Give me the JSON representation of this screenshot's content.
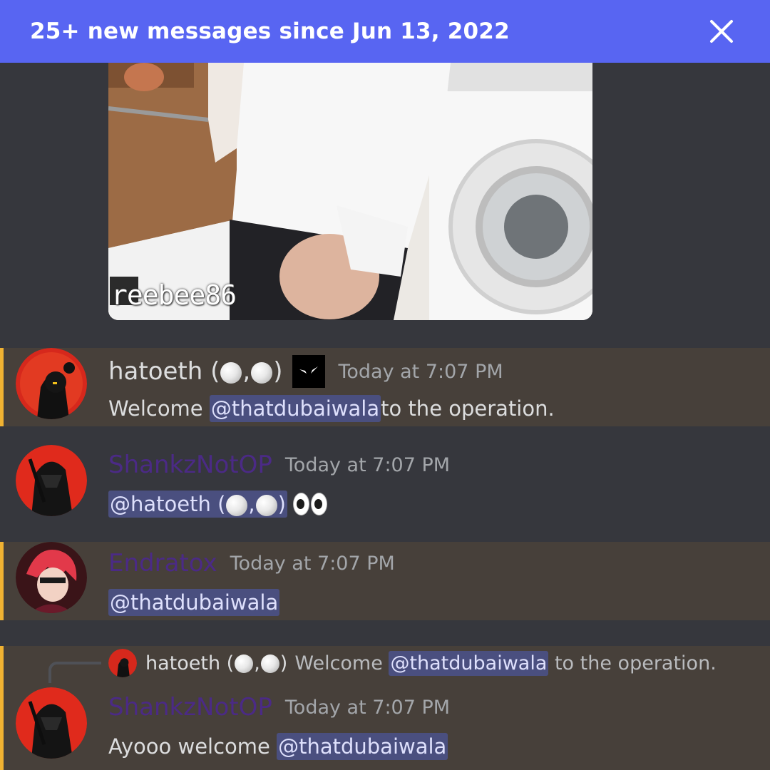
{
  "banner": {
    "text": "25+ new messages since Jun 13, 2022",
    "close_icon": "close-icon"
  },
  "media": {
    "watermark": "reebee86"
  },
  "messages": [
    {
      "username": "hatoeth (",
      "username_mid": ",",
      "username_end": ")",
      "timestamp": "Today at 7:07 PM",
      "text_before": "Welcome ",
      "mention": "@thatdubaiwala",
      "text_after": " to the operation."
    },
    {
      "username": "ShankzNotOP",
      "timestamp": "Today at 7:07 PM",
      "mention_a": "@hatoeth (",
      "mention_b": ",",
      "mention_c": ")"
    },
    {
      "username": "Endratox",
      "timestamp": "Today at 7:07 PM",
      "mention": "@thatdubaiwala"
    },
    {
      "reply": {
        "username": "hatoeth (",
        "username_mid": ",",
        "username_end": ")",
        "text_before": "Welcome ",
        "mention": "@thatdubaiwala",
        "text_after": " to the operation."
      },
      "username": "ShankzNotOP",
      "timestamp": "Today at 7:07 PM",
      "text_before": "Ayooo welcome ",
      "mention": "@thatdubaiwala"
    }
  ],
  "colors": {
    "banner": "#5865f2",
    "highlight": "#47403a",
    "highlight_bar": "#f0b232",
    "mention_bg": "#4a4f7f",
    "username_purple": "#4b2a86"
  }
}
